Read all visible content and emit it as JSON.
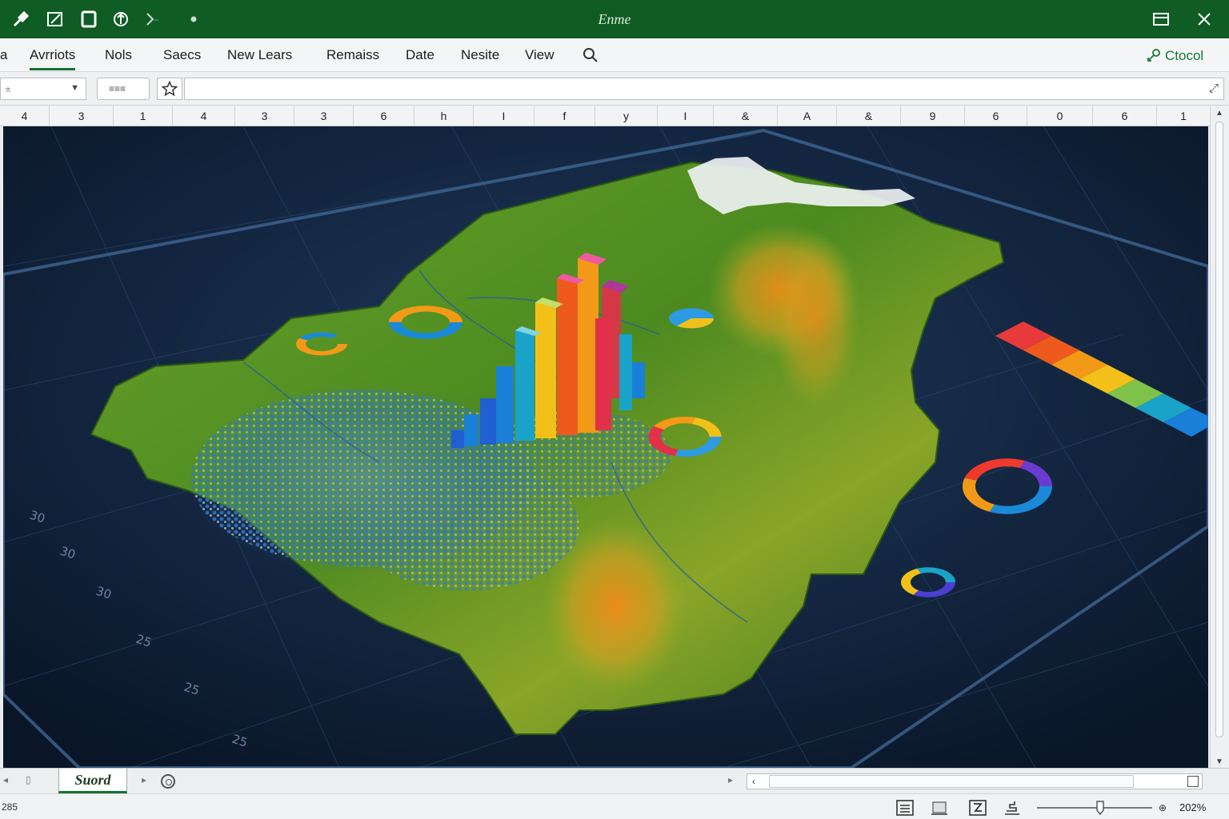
{
  "window": {
    "title": "Enme"
  },
  "menu": {
    "partial_left": "a",
    "items": [
      "Avrriots",
      "Nols",
      "Saecs",
      "New Lears",
      "Remaiss",
      "Date",
      "Nesite",
      "View"
    ],
    "share_label": "Ctocol"
  },
  "formula_bar": {
    "name_box": "ㅊ",
    "fx_text": "≡≡≡"
  },
  "columns": [
    "4",
    "3",
    "1",
    "4",
    "3",
    "3",
    "6",
    "h",
    "I",
    "f",
    "y",
    "I",
    "&",
    "A",
    "&",
    "9",
    "6",
    "0",
    "6",
    "1"
  ],
  "sheet": {
    "tab_label": "Suord"
  },
  "status": {
    "text": "285",
    "zoom": "202%"
  },
  "grid_labels": [
    "30",
    "30",
    "30",
    "25",
    "25",
    "25"
  ],
  "colors": {
    "title_bar": "#0f5c24",
    "accent": "#13722e",
    "ocean": "#0c1c33",
    "land_green": "#4f8f1f",
    "land_orange": "#e2861c",
    "bar_palette": [
      "#1f5fd1",
      "#1a7fd8",
      "#1aa3c8",
      "#f2c019",
      "#f29a17",
      "#ee5a1c",
      "#e3304a",
      "#b0369c"
    ]
  }
}
